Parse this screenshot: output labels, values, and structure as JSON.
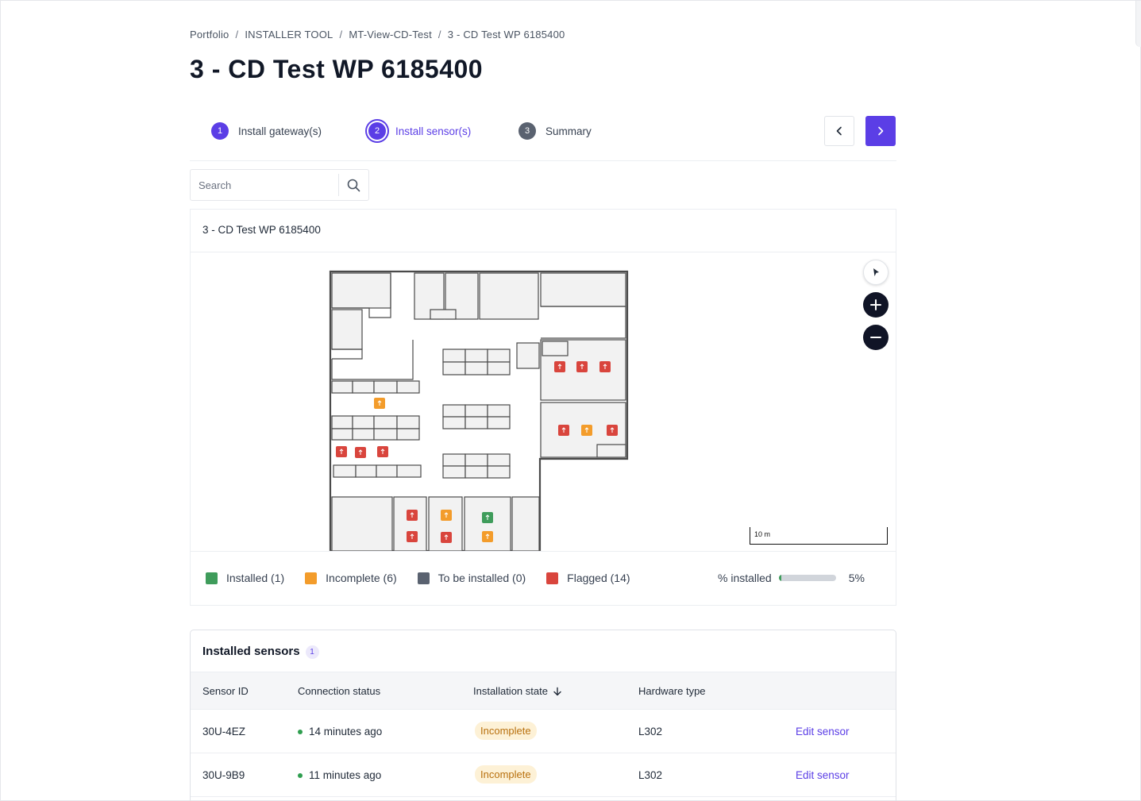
{
  "breadcrumb": [
    "Portfolio",
    "INSTALLER TOOL",
    "MT-View-CD-Test",
    "3 - CD Test WP 6185400"
  ],
  "breadcrumb_separator": "/",
  "page_title": "3 - CD Test WP 6185400",
  "steps": [
    {
      "number": "1",
      "label": "Install gateway(s)",
      "state": "done"
    },
    {
      "number": "2",
      "label": "Install sensor(s)",
      "state": "current"
    },
    {
      "number": "3",
      "label": "Summary",
      "state": "pending"
    }
  ],
  "search": {
    "placeholder": "Search"
  },
  "map": {
    "title": "3 - CD Test WP 6185400",
    "scale_label": "10 m",
    "markers": [
      {
        "status": "flagged"
      },
      {
        "status": "flagged"
      },
      {
        "status": "flagged"
      },
      {
        "status": "flagged"
      },
      {
        "status": "incomplete"
      },
      {
        "status": "flagged"
      },
      {
        "status": "incomplete"
      },
      {
        "status": "flagged"
      },
      {
        "status": "flagged"
      },
      {
        "status": "flagged"
      },
      {
        "status": "flagged"
      },
      {
        "status": "flagged"
      },
      {
        "status": "incomplete"
      },
      {
        "status": "flagged"
      },
      {
        "status": "installed"
      },
      {
        "status": "incomplete"
      },
      {
        "status": "flagged"
      },
      {
        "status": "flagged"
      },
      {
        "status": "incomplete"
      },
      {
        "status": "flagged"
      },
      {
        "status": "flagged"
      }
    ]
  },
  "legend": {
    "installed": "Installed (1)",
    "incomplete": "Incomplete (6)",
    "to_be_installed": "To be installed (0)",
    "flagged": "Flagged (14)",
    "percent_label": "% installed",
    "percent_value": "5%",
    "percent_fraction": 0.05
  },
  "colors": {
    "accent": "#5b3ee6",
    "installed": "#3f9c5b",
    "incomplete": "#f39c2b",
    "to_be_installed": "#5a6270",
    "flagged": "#d9453d"
  },
  "sensors": {
    "title": "Installed sensors",
    "count": "1",
    "columns": [
      "Sensor ID",
      "Connection status",
      "Installation state",
      "Hardware type"
    ],
    "rows": [
      {
        "id": "30U-4EZ",
        "connection": "14 minutes ago",
        "state": "Incomplete",
        "hardware": "L302",
        "action": "Edit sensor"
      },
      {
        "id": "30U-9B9",
        "connection": "11 minutes ago",
        "state": "Incomplete",
        "hardware": "L302",
        "action": "Edit sensor"
      }
    ]
  }
}
